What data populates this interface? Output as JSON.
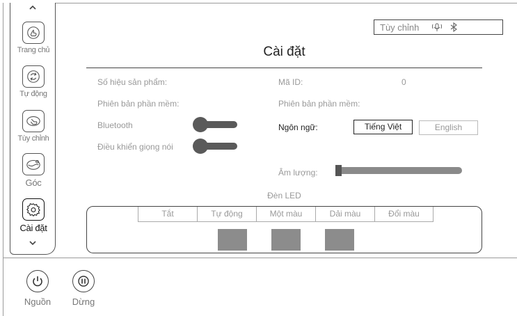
{
  "sidebar": {
    "items": [
      {
        "label": "Trang chủ",
        "icon": "hand-touch-icon"
      },
      {
        "label": "Tự động",
        "icon": "refresh-arrows-icon"
      },
      {
        "label": "Tùy chỉnh",
        "icon": "finger-swipe-icon"
      },
      {
        "label": "Góc",
        "icon": "recline-chair-icon"
      },
      {
        "label": "Cài đặt",
        "icon": "gear-icon",
        "active": true
      }
    ]
  },
  "header": {
    "box_label": "Tùy chỉnh",
    "box_icons": [
      "voice-icon",
      "bluetooth-icon"
    ]
  },
  "page": {
    "title": "Cài đặt"
  },
  "info": {
    "product_label": "Số hiệu sản phẩm:",
    "firmware_label_left": "Phiên bản phần mềm:",
    "bluetooth_label": "Bluetooth",
    "voice_label": "Điều khiển giọng nói",
    "id_label": "Mã ID:",
    "id_value": "0",
    "firmware_label_right": "Phiên bản phần mềm:",
    "language_label": "Ngôn ngữ:",
    "volume_label": "Âm lượng:"
  },
  "language": {
    "options": [
      "Tiếng Việt",
      "English"
    ],
    "selected": "Tiếng Việt"
  },
  "toggles": {
    "bluetooth_on": false,
    "voice_on": false
  },
  "volume": {
    "level": 0.0
  },
  "led": {
    "title": "Đèn LED",
    "tabs": [
      "Tắt",
      "Tự động",
      "Một màu",
      "Dải màu",
      "Đổi màu"
    ],
    "swatch_color": "#8c8c8c"
  },
  "controls": {
    "power_label": "Nguồn",
    "pause_label": "Dừng"
  }
}
